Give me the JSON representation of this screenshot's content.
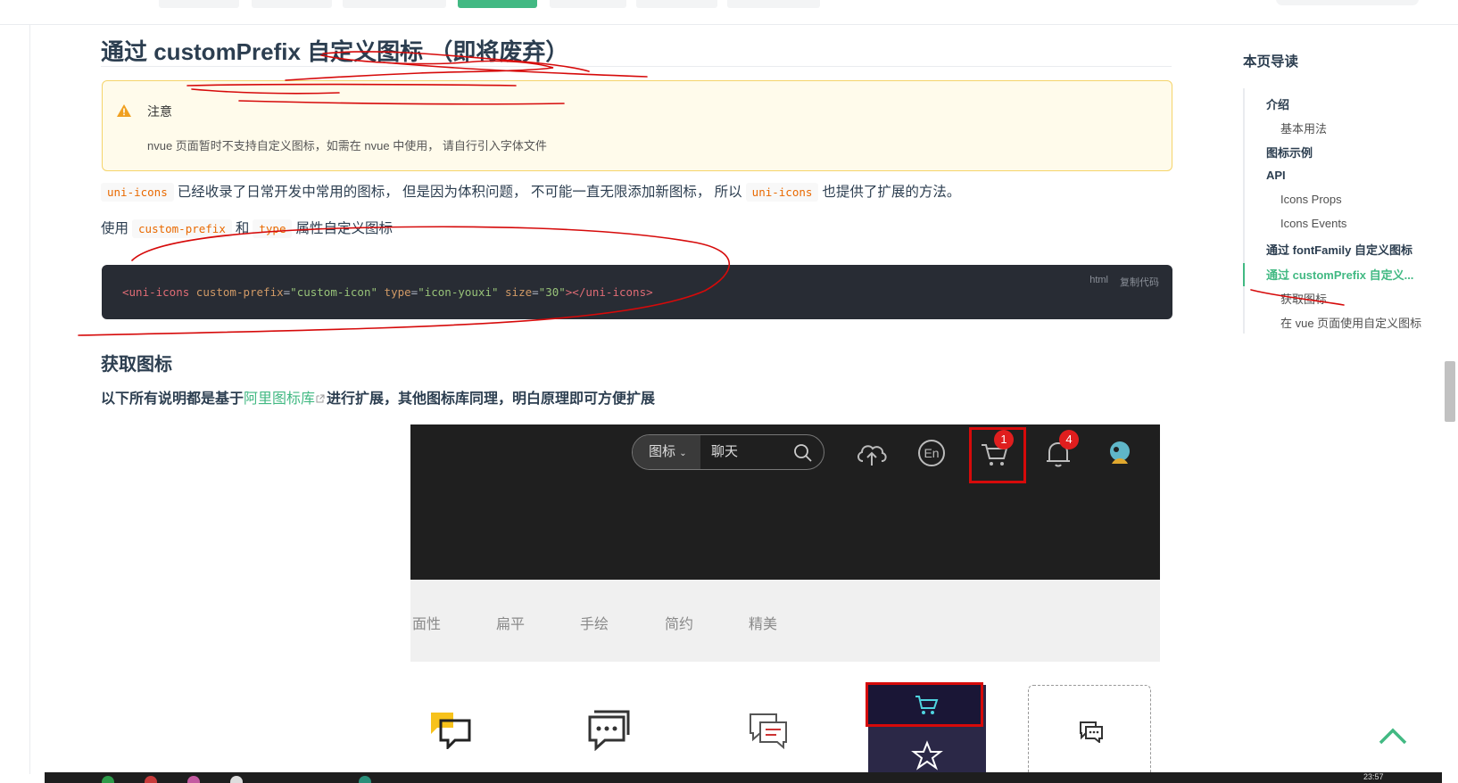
{
  "main": {
    "title": "通过 customPrefix 自定义图标 （即将废弃）",
    "warning": {
      "heading": "注意",
      "body": "nvue 页面暂时不支持自定义图标，如需在 nvue 中使用， 请自行引入字体文件"
    },
    "para1": {
      "code1": "uni-icons",
      "text1": "已经收录了日常开发中常用的图标， 但是因为体积问题， 不可能一直无限添加新图标， 所以",
      "code2": "uni-icons",
      "text2": "也提供了扩展的方法。"
    },
    "para2": {
      "text1": "使用",
      "code1": "custom-prefix",
      "text2": "和",
      "code2": "type",
      "text3": "属性自定义图标"
    },
    "codeblock": {
      "lang": "html",
      "copy_label": "复制代码",
      "tag_open": "<uni-icons",
      "attr1": "custom-prefix",
      "val1": "\"custom-icon\"",
      "attr2": "type",
      "val2": "\"icon-youxi\"",
      "attr3": "size",
      "val3": "\"30\"",
      "tag_close": "></uni-icons>"
    },
    "section2_title": "获取图标",
    "section2_text_before": "以下所有说明都是基于",
    "section2_link": "阿里图标库",
    "section2_text_after": "进行扩展，其他图标库同理，明白原理即可方便扩展"
  },
  "screenshot": {
    "search_category": "图标",
    "search_query": "聊天",
    "cart_badge": "1",
    "bell_badge": "4",
    "lang_label": "En",
    "categories": [
      "面性",
      "扁平",
      "手绘",
      "简约",
      "精美"
    ]
  },
  "toc": {
    "title": "本页导读",
    "items": [
      {
        "label": "介绍"
      },
      {
        "label": "基本用法"
      },
      {
        "label": "图标示例"
      },
      {
        "label": "API"
      },
      {
        "label": "Icons Props"
      },
      {
        "label": "Icons Events"
      },
      {
        "label": "通过 fontFamily 自定义图标"
      },
      {
        "label": "通过 customPrefix 自定义..."
      },
      {
        "label": "获取图标"
      },
      {
        "label": "在 vue 页面使用自定义图标"
      }
    ]
  },
  "taskbar": {
    "clock": "23:57"
  },
  "colors": {
    "accent": "#42b983",
    "annotation_red": "#d60a0a",
    "code_bg": "#282c34",
    "warning_bg": "#fffbeb"
  }
}
